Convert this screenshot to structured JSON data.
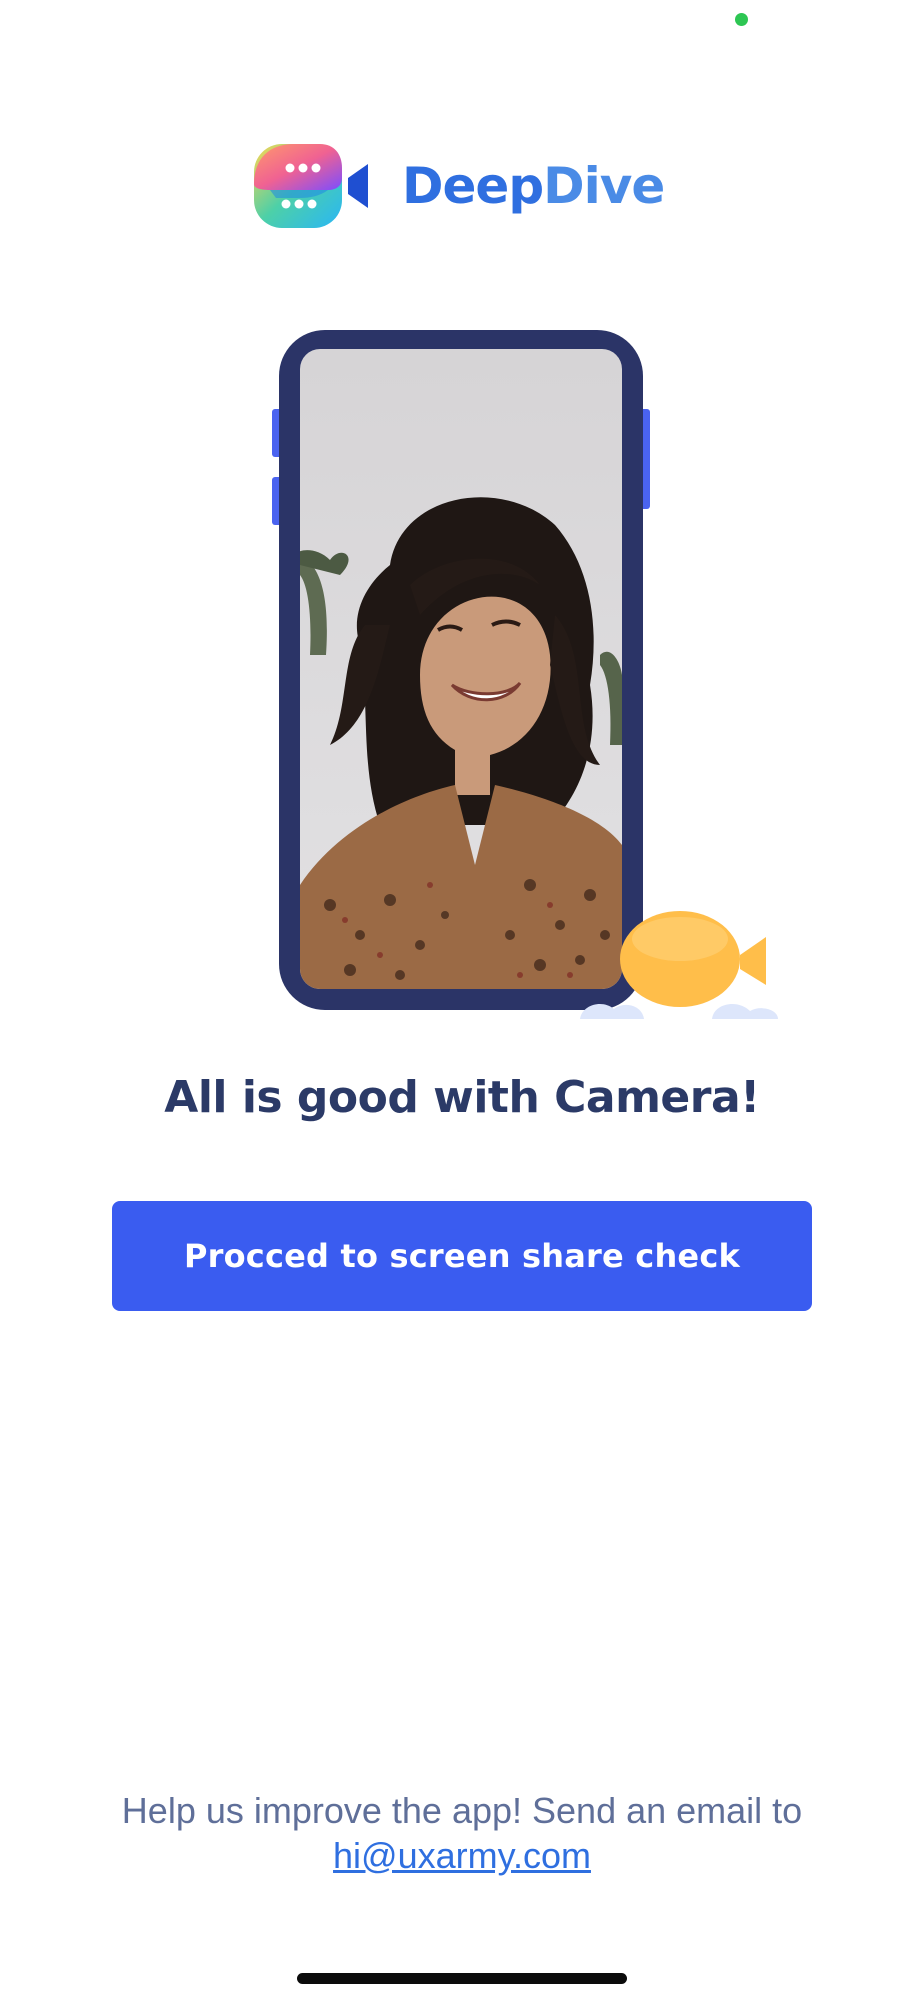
{
  "brand": {
    "name_part1": "Deep",
    "name_part2": "Dive",
    "logo_icon": "video-chat-logo-icon",
    "colors": {
      "primary": "#2f6fe0",
      "secondary": "#4a8be6"
    }
  },
  "status": {
    "indicator_color": "#2dc653"
  },
  "illustration": {
    "device": "phone-illustration",
    "photo": "smiling-woman-photo",
    "badge_icon": "video-camera-icon",
    "colors": {
      "frame": "#2b3467",
      "buttons": "#4a63f0",
      "camera": "#ffbe4a"
    }
  },
  "headline": "All is good with Camera!",
  "primary_action": {
    "label": "Procced to screen share check",
    "color": "#3a5cf0"
  },
  "footer": {
    "text": "Help us improve the app! Send an email to",
    "email": "hi@uxarmy.com"
  }
}
